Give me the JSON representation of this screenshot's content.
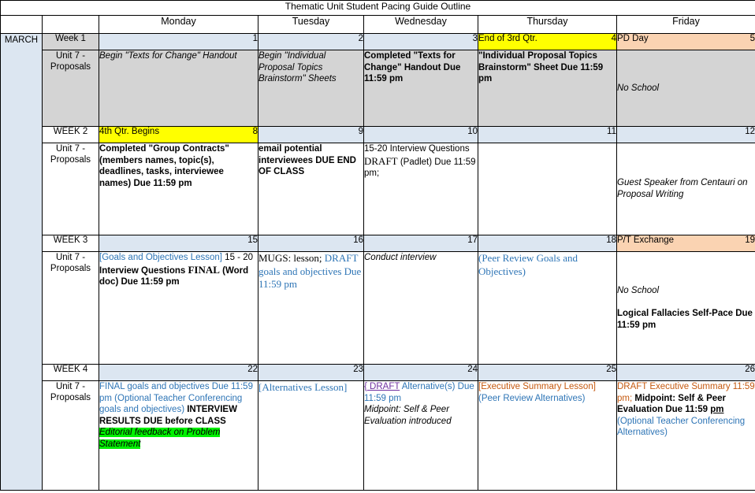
{
  "document": {
    "title": "Thematic Unit Student Pacing Guide Outline"
  },
  "colors": {
    "date_default_bg": "#dce6f1",
    "date_highlight_yellow": "#ffff00",
    "date_highlight_peach": "#fad3b2",
    "shaded_row_bg": "#d4d4d4",
    "month_column_bg": "#dce6f1",
    "blue_text": "#2e75b6",
    "orange_text": "#c55a11",
    "visited_link": "#7030a0",
    "green_highlight": "#00f000"
  },
  "header": {
    "corner_month_label": "",
    "corner_week_label": "",
    "days": [
      "Monday",
      "Tuesday",
      "Wednesday",
      "Thursday",
      "Friday"
    ]
  },
  "month_label": "MARCH",
  "weeks": [
    {
      "week_label": "Week 1",
      "unit_label": "Unit 7 - Proposals",
      "shaded": true,
      "days": [
        {
          "date": "1",
          "event": "",
          "style": "default",
          "runs": [
            {
              "text": "Begin \"Texts for Change\" Handout",
              "style": "i"
            }
          ]
        },
        {
          "date": "2",
          "event": "",
          "style": "default",
          "runs": [
            {
              "text": "Begin \"Individual Proposal Topics Brainstorm\" Sheets",
              "style": "i"
            }
          ]
        },
        {
          "date": "3",
          "event": "",
          "style": "default",
          "runs": [
            {
              "text": "Completed \"Texts for Change\" Handout Due 11:59 pm",
              "style": "b"
            }
          ]
        },
        {
          "date": "4",
          "event": "End of 3rd Qtr.",
          "style": "yellow",
          "runs": [
            {
              "text": "\"Individual Proposal Topics Brainstorm\" Sheet Due 11:59 pm",
              "style": "b"
            }
          ]
        },
        {
          "date": "5",
          "event": "PD Day",
          "style": "peach",
          "vertical": "middle",
          "runs": [
            {
              "text": "No School",
              "style": "i"
            }
          ]
        }
      ]
    },
    {
      "week_label": "WEEK 2",
      "unit_label": "Unit 7 - Proposals",
      "shaded": false,
      "days": [
        {
          "date": "8",
          "event": "4th Qtr. Begins",
          "style": "yellow",
          "runs": [
            {
              "text": "Completed \"Group Contracts\" (members names, topic(s), deadlines, tasks, interviewee names) Due 11:59 pm",
              "style": "b"
            }
          ]
        },
        {
          "date": "9",
          "event": "",
          "style": "default",
          "runs": [
            {
              "text": "email potential interviewees DUE END OF CLASS",
              "style": "b"
            }
          ]
        },
        {
          "date": "10",
          "event": "",
          "style": "default",
          "runs": [
            {
              "text": "15-20 Interview Questions ",
              "style": "plain"
            },
            {
              "text": "DRAFT",
              "style": "serif"
            },
            {
              "text": " (Padlet) Due 11:59 pm;",
              "style": "plain"
            }
          ]
        },
        {
          "date": "11",
          "event": "",
          "style": "default",
          "runs": []
        },
        {
          "date": "12",
          "event": "",
          "style": "default",
          "vertical": "middle",
          "runs": [
            {
              "text": "Guest Speaker from Centauri on Proposal Writing",
              "style": "i"
            }
          ]
        }
      ]
    },
    {
      "week_label": "WEEK 3",
      "unit_label": "Unit 7 - Proposals",
      "shaded": false,
      "days": [
        {
          "date": "15",
          "event": "",
          "style": "default",
          "runs": [
            {
              "text": " [Goals and Objectives Lesson]",
              "style": "blue"
            },
            {
              "text": " 15 - 20 ",
              "style": "plain"
            },
            {
              "text": "Interview Questions ",
              "style": "b"
            },
            {
              "text": "FINAL",
              "style": "serifb"
            },
            {
              "text": " (Word doc) Due 11:59 pm",
              "style": "b"
            }
          ]
        },
        {
          "date": "16",
          "event": "",
          "style": "default",
          "runs": [
            {
              "text": "MUGS: lesson;",
              "style": "serif"
            },
            {
              "text": " DRAFT goals and objectives Due 11:59 pm",
              "style": "serif-blue"
            }
          ]
        },
        {
          "date": "17",
          "event": "",
          "style": "default",
          "runs": [
            {
              "text": "Conduct interview",
              "style": "i"
            }
          ]
        },
        {
          "date": "18",
          "event": "",
          "style": "default",
          "runs": [
            {
              "text": " (Peer Review Goals and Objectives)",
              "style": "serif-blue"
            }
          ]
        },
        {
          "date": "19",
          "event": "P/T Exchange",
          "style": "peach",
          "vertical": "middle",
          "runs": [
            {
              "text": "No School",
              "style": "i"
            },
            {
              "text": "\n",
              "style": "break"
            },
            {
              "text": "\n",
              "style": "break"
            },
            {
              "text": "Logical Fallacies Self-Pace Due 11:59 pm",
              "style": "b"
            }
          ]
        }
      ]
    },
    {
      "week_label": "WEEK 4",
      "unit_label": "Unit 7 - Proposals",
      "shaded": false,
      "days": [
        {
          "date": "22",
          "event": "",
          "style": "default",
          "runs": [
            {
              "text": "FINAL goals and objectives Due 11:59 pm (Optional Teacher Conferencing goals and objectives)",
              "style": "blue"
            },
            {
              "text": " INTERVIEW RESULTS DUE before CLASS",
              "style": "b"
            },
            {
              "text": "\n",
              "style": "break"
            },
            {
              "text": "Editorial feedback on Problem Statement",
              "style": "hl-green-i"
            }
          ]
        },
        {
          "date": "23",
          "event": "",
          "style": "default",
          "runs": [
            {
              "text": "[Alternatives Lesson]",
              "style": "serif-blue"
            }
          ]
        },
        {
          "date": "24",
          "event": "",
          "style": "default",
          "runs": [
            {
              "text": "{ DRAFT",
              "style": "visited-link"
            },
            {
              "text": " Alternative(s) Due 11:59 pm",
              "style": "blue"
            },
            {
              "text": "\n",
              "style": "break"
            },
            {
              "text": "Midpoint: Self & Peer Evaluation introduced",
              "style": "i"
            }
          ]
        },
        {
          "date": "25",
          "event": "",
          "style": "default",
          "runs": [
            {
              "text": "[Executive Summary Lesson]",
              "style": "orange"
            },
            {
              "text": "\n",
              "style": "break"
            },
            {
              "text": "(Peer Review Alternatives)",
              "style": "blue"
            }
          ]
        },
        {
          "date": "26",
          "event": "",
          "style": "default",
          "runs": [
            {
              "text": "DRAFT Executive Summary 11:59 pm;",
              "style": "orange"
            },
            {
              "text": " Midpoint: Self & Peer Evaluation Due 11:59 ",
              "style": "b"
            },
            {
              "text": "pm ",
              "style": "b-u"
            },
            {
              "text": " (Optional Teacher Conferencing Alternatives)",
              "style": "blue"
            }
          ]
        }
      ]
    }
  ]
}
